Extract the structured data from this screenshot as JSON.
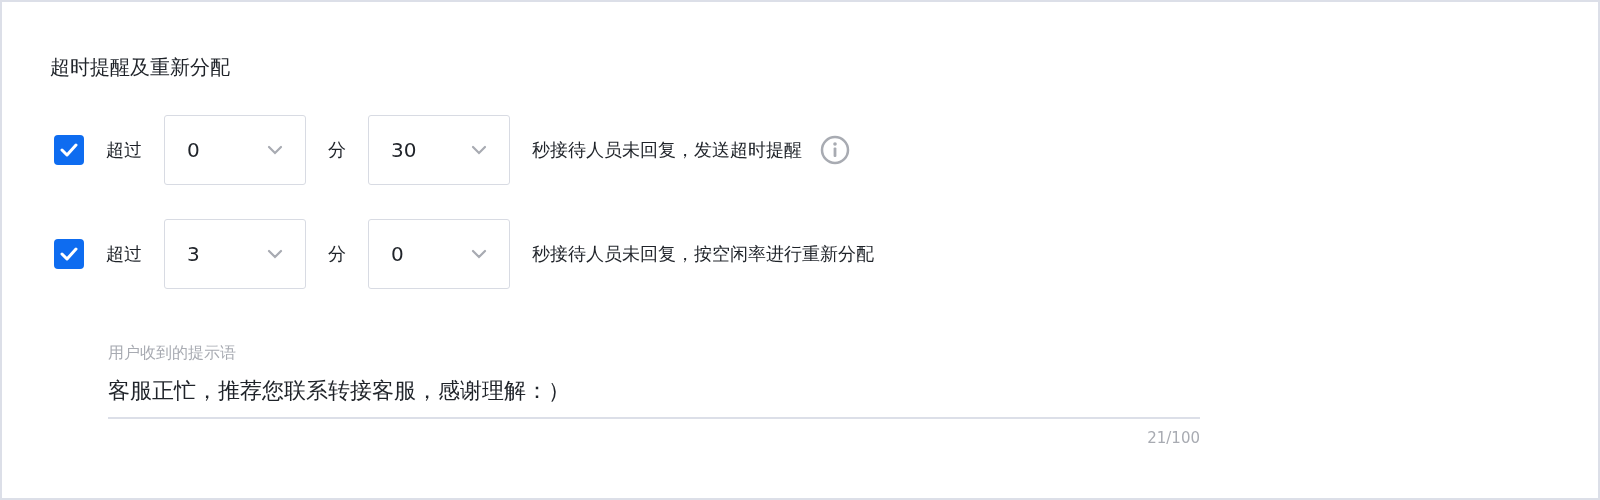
{
  "section": {
    "title": "超时提醒及重新分配"
  },
  "rules": [
    {
      "checked": true,
      "prefix": "超过",
      "minutes": "0",
      "minute_unit": "分",
      "seconds": "30",
      "suffix": "秒接待人员未回复，发送超时提醒",
      "info": true
    },
    {
      "checked": true,
      "prefix": "超过",
      "minutes": "3",
      "minute_unit": "分",
      "seconds": "0",
      "suffix": "秒接待人员未回复，按空闲率进行重新分配",
      "info": false
    }
  ],
  "message": {
    "label": "用户收到的提示语",
    "value": "客服正忙，推荐您联系转接客服，感谢理解：）",
    "counter": "21/100"
  }
}
